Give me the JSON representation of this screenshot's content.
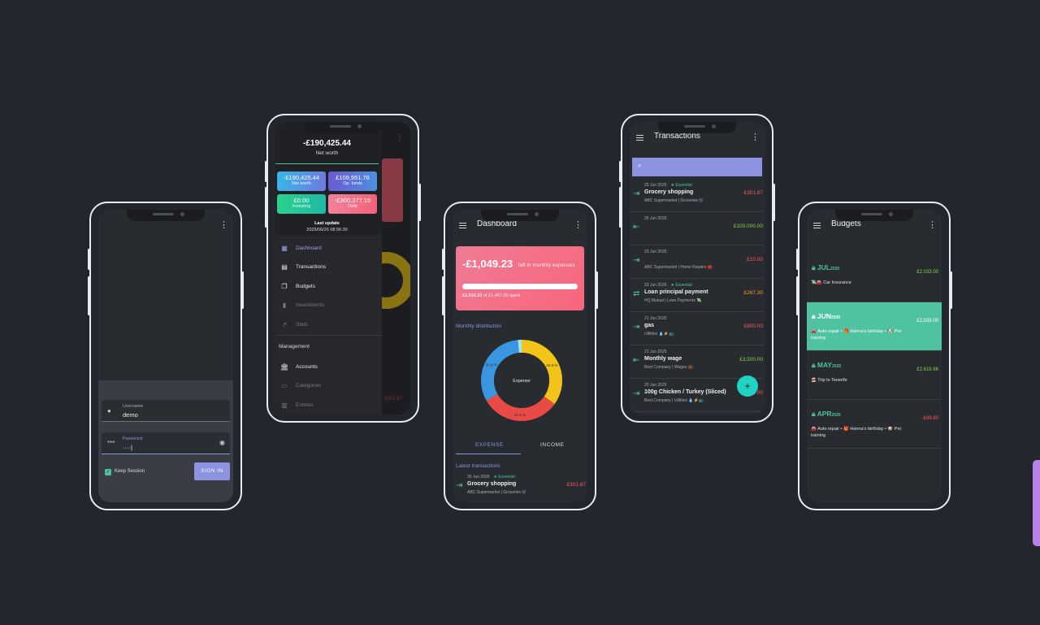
{
  "colors": {
    "background": "#23262c",
    "accent": "#8c93e0",
    "positive": "#7fd64a",
    "negative": "#ff5a5f",
    "teal": "#4fc3a1"
  },
  "login": {
    "username_label": "Username",
    "username_value": "demo",
    "password_label": "Password",
    "password_value": "····|",
    "keep_session": "Keep Session",
    "keep_session_checked": true,
    "signin": "SIGN IN"
  },
  "drawer": {
    "net_worth_amount": "-£190,425.44",
    "net_worth_label": "Net worth",
    "tiles": [
      {
        "amount": "-£190,425.44",
        "label": "Net worth",
        "color": "#4aa3e8"
      },
      {
        "amount": "£109,951.76",
        "label": "Op. funds",
        "color": "#7a68d8"
      },
      {
        "amount": "£0.00",
        "label": "Investing",
        "color": "#2fcf8a"
      },
      {
        "amount": "-£300,377.19",
        "label": "Debt",
        "color": "#f06e84"
      }
    ],
    "last_update_label": "Last update",
    "last_update_value": "2025/06/26 08:56:30",
    "nav": [
      {
        "label": "Dashboard",
        "icon": "dashboard-icon"
      },
      {
        "label": "Transactions",
        "icon": "receipt-icon"
      },
      {
        "label": "Budgets",
        "icon": "copy-icon"
      },
      {
        "label": "Investments",
        "icon": "bar-chart-icon"
      },
      {
        "label": "Stats",
        "icon": "trend-icon"
      }
    ],
    "management_label": "Management",
    "management": [
      {
        "label": "Accounts",
        "icon": "bank-icon"
      },
      {
        "label": "Categories",
        "icon": "folder-icon"
      },
      {
        "label": "Entities",
        "icon": "building-icon"
      }
    ],
    "behind_amount": "£301.87"
  },
  "dashboard": {
    "title": "Dashboard",
    "left_amount": "-£1,049.23",
    "left_text": "left in monthly expenses",
    "progress_fraction": 1.0,
    "spent_text_a": "£2,516.23",
    "spent_text_b": "of £1,467.00 spent",
    "monthly_distribution": "Monthly distribution",
    "donut_center": "Expense",
    "tab_expense": "EXPENSE",
    "tab_income": "INCOME",
    "latest_transactions": "Latest transactions",
    "latest": {
      "date": "25 Jun 2025",
      "tag": "★ Essential",
      "name": "Grocery shopping",
      "sub": "ABC Supermarket | Groceries 🛒",
      "amount": "£301.87"
    },
    "chart_data": {
      "type": "pie",
      "categories": [
        "",
        "",
        "",
        ""
      ],
      "values": [
        34.9,
        31.8,
        31.8,
        1.5
      ],
      "labels": [
        "34.9 %",
        "31.8 %",
        "31.8 %",
        ""
      ],
      "colors": [
        "#f2c318",
        "#e84b45",
        "#3a96e0",
        "#a3e4ee"
      ],
      "title": "",
      "xlabel": "",
      "ylabel": ""
    }
  },
  "transactions": {
    "title": "Transactions",
    "items": [
      {
        "date": "25 Jun 2025",
        "tag": "★ Essential",
        "name": "Grocery shopping",
        "sub": "ABC Supermarket | Groceries 🛒",
        "amount": "£301.87",
        "kind": "neg",
        "icon": "out-icon"
      },
      {
        "date": "25 Jun 2025",
        "tag": "",
        "name": "",
        "sub": "",
        "amount": "£100,000.00",
        "kind": "pos",
        "icon": "in-icon"
      },
      {
        "date": "23 Jun 2025",
        "tag": "",
        "name": "",
        "sub": "ABC Supermarket | Home Repairs 🧰",
        "amount": "£10.00",
        "kind": "neg",
        "icon": "out-icon"
      },
      {
        "date": "23 Jun 2025",
        "tag": "★ Essential",
        "name": "Loan principal payment",
        "sub": "HQ Mutual | Loan Payments 💸",
        "amount": "£267.30",
        "kind": "warn",
        "icon": "transfer-icon"
      },
      {
        "date": "21 Jun 2025",
        "tag": "",
        "name": "gas",
        "sub": "Utilities 💧⚡📺",
        "amount": "£800.00",
        "kind": "neg",
        "icon": "out-icon"
      },
      {
        "date": "21 Jun 2025",
        "tag": "",
        "name": "Monthly wage",
        "sub": "Best Company | Wages 💼",
        "amount": "£3,500.00",
        "kind": "pos",
        "icon": "in-icon"
      },
      {
        "date": "20 Jun 2025",
        "tag": "",
        "name": "100g Chicken / Turkey (Sliced)",
        "sub": "Best Company | Utilities 💧⚡📺",
        "amount": "£9.00",
        "kind": "neg",
        "icon": "out-icon"
      }
    ]
  },
  "budgets": {
    "title": "Budgets",
    "items": [
      {
        "month": "JUL",
        "year": "2025",
        "desc": "💸🚘 Car Insurance",
        "amount": "£2,033.00",
        "kind": "pos",
        "highlight": false
      },
      {
        "month": "JUN",
        "year": "2025",
        "desc": "🚘 Auto repair • 🎁 Hanna's birthday • 🐶 Pet training",
        "amount": "£2,033.00",
        "kind": "pos",
        "highlight": true
      },
      {
        "month": "MAY",
        "year": "2025",
        "desc": "🏖️ Trip to Tenerife",
        "amount": "£2,618.66",
        "kind": "pos",
        "highlight": false
      },
      {
        "month": "APR",
        "year": "2025",
        "desc": "🚘 Auto repair • 🎁 Hanna's birthday • 🐶 Pet training",
        "amount": "-£89.60",
        "kind": "neg",
        "highlight": false
      }
    ]
  }
}
